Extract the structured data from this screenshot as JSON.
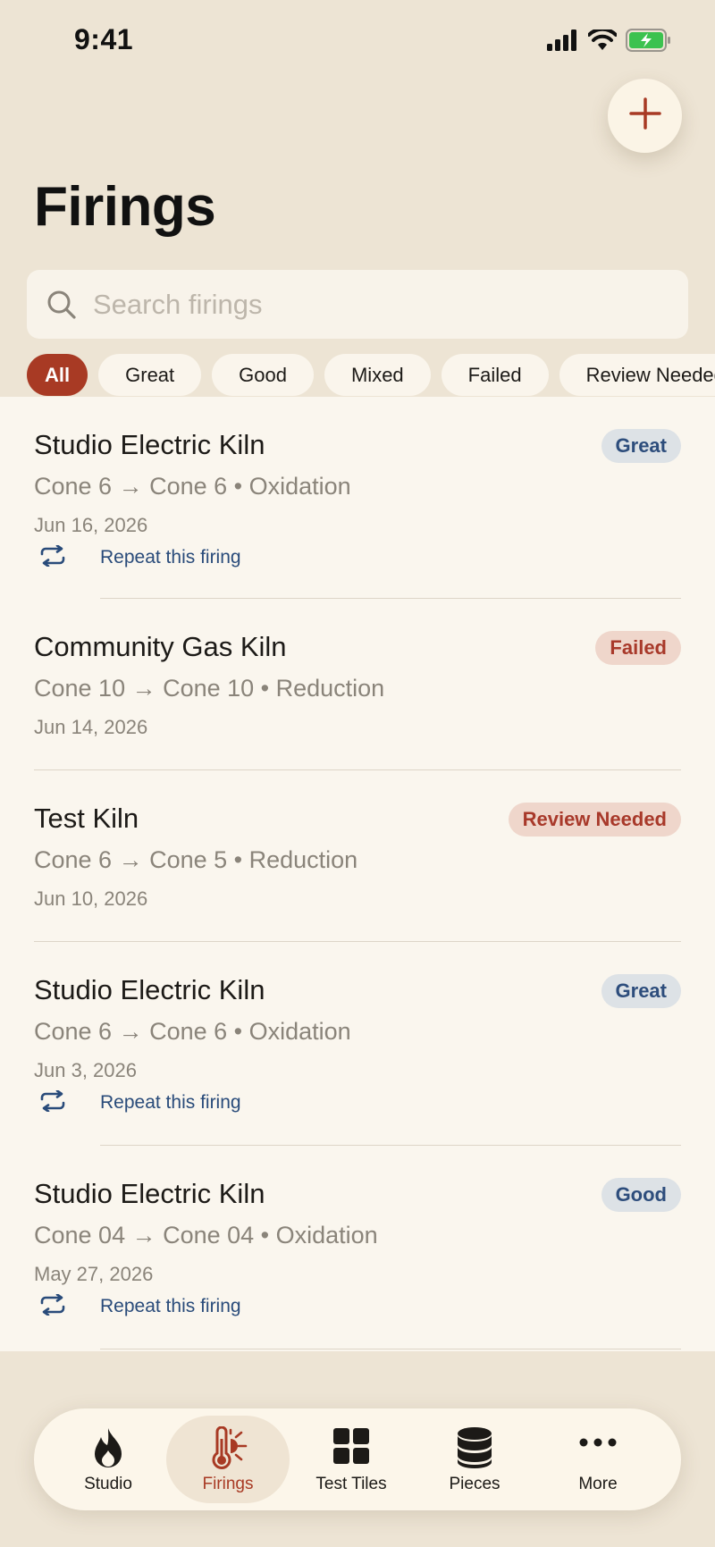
{
  "status_bar": {
    "time": "9:41"
  },
  "header": {
    "title": "Firings",
    "add_icon": "plus-icon"
  },
  "search": {
    "placeholder": "Search firings",
    "value": ""
  },
  "filters": [
    {
      "label": "All",
      "active": true
    },
    {
      "label": "Great",
      "active": false
    },
    {
      "label": "Good",
      "active": false
    },
    {
      "label": "Mixed",
      "active": false
    },
    {
      "label": "Failed",
      "active": false
    },
    {
      "label": "Review Needed",
      "active": false
    }
  ],
  "firings": [
    {
      "kiln": "Studio Electric Kiln",
      "cones": "Cone 6 → Cone 6 • Oxidation",
      "date": "Jun 16, 2026",
      "status": "Great",
      "repeat": "Repeat this firing"
    },
    {
      "kiln": "Community Gas Kiln",
      "cones": "Cone 10 → Cone 10 • Reduction",
      "date": "Jun 14, 2026",
      "status": "Failed"
    },
    {
      "kiln": "Test Kiln",
      "cones": "Cone 6 → Cone 5 • Reduction",
      "date": "Jun 10, 2026",
      "status": "Review Needed"
    },
    {
      "kiln": "Studio Electric Kiln",
      "cones": "Cone 6 → Cone 6 • Oxidation",
      "date": "Jun 3, 2026",
      "status": "Great",
      "repeat": "Repeat this firing"
    },
    {
      "kiln": "Studio Electric Kiln",
      "cones": "Cone 04 → Cone 04 • Oxidation",
      "date": "May 27, 2026",
      "status": "Good",
      "repeat": "Repeat this firing"
    }
  ],
  "tab_bar": {
    "tabs": [
      {
        "label": "Studio",
        "icon": "flame-icon",
        "active": false
      },
      {
        "label": "Firings",
        "icon": "thermometer-sun-icon",
        "active": true
      },
      {
        "label": "Test Tiles",
        "icon": "grid-icon",
        "active": false
      },
      {
        "label": "Pieces",
        "icon": "cylinder-stack-icon",
        "active": false
      },
      {
        "label": "More",
        "icon": "ellipsis-icon",
        "active": false
      }
    ]
  },
  "colors": {
    "background": "#ede4d4",
    "accent": "#a83a24",
    "link": "#294b7a",
    "badge_blue_bg": "#dde2e6",
    "badge_red_bg": "#efd6cb"
  }
}
